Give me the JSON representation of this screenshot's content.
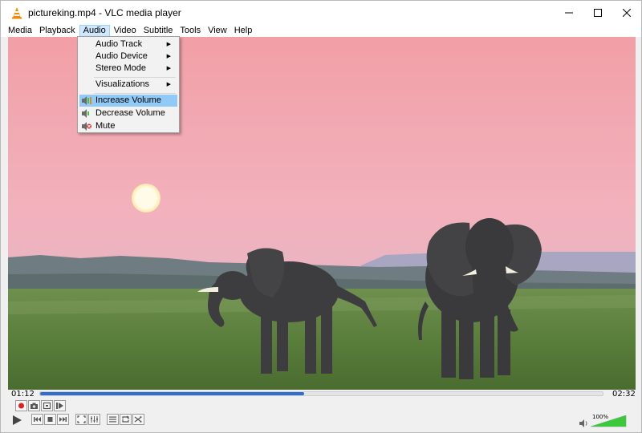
{
  "window": {
    "title": "pictureking.mp4 - VLC media player"
  },
  "menubar": {
    "items": [
      {
        "label": "Media"
      },
      {
        "label": "Playback"
      },
      {
        "label": "Audio",
        "active": true
      },
      {
        "label": "Video"
      },
      {
        "label": "Subtitle"
      },
      {
        "label": "Tools"
      },
      {
        "label": "View"
      },
      {
        "label": "Help"
      }
    ]
  },
  "audio_menu": {
    "items": [
      {
        "label": "Audio Track",
        "submenu": true
      },
      {
        "label": "Audio Device",
        "submenu": true
      },
      {
        "label": "Stereo Mode",
        "submenu": true
      },
      {
        "label": "Visualizations",
        "submenu": true
      },
      {
        "label": "Increase Volume",
        "icon": "volume-up-icon",
        "highlighted": true
      },
      {
        "label": "Decrease Volume",
        "icon": "volume-down-icon"
      },
      {
        "label": "Mute",
        "icon": "mute-icon"
      }
    ]
  },
  "playback": {
    "elapsed": "01:12",
    "total": "02:32",
    "progress_fraction": 0.47
  },
  "volume": {
    "label": "100%",
    "level_fraction": 1.0
  },
  "colors": {
    "accent": "#2f6fce",
    "menu_highlight": "#91c9f7",
    "volume_green": "#3cc83c"
  }
}
